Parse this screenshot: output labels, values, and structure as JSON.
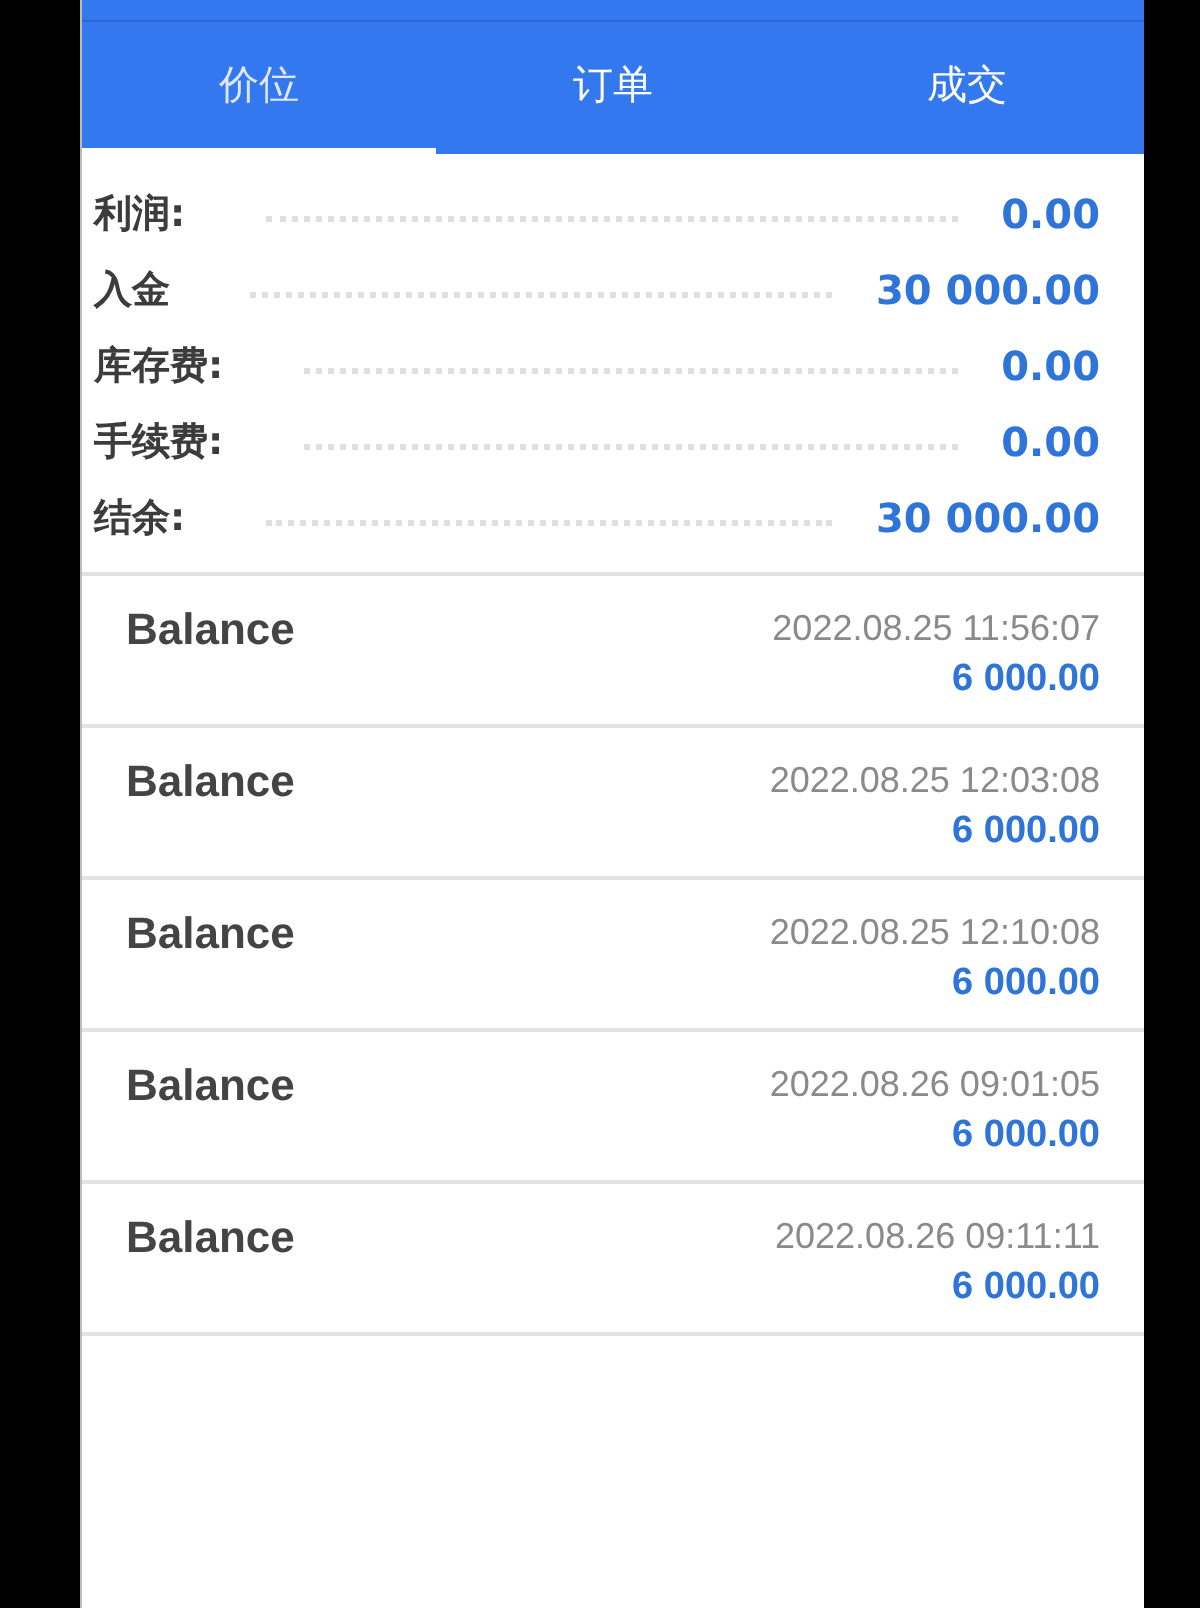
{
  "tabs": [
    {
      "label": "价位",
      "selected": true
    },
    {
      "label": "订单",
      "selected": false
    },
    {
      "label": "成交",
      "selected": false
    }
  ],
  "summary": [
    {
      "label": "利润:",
      "value": "0.00"
    },
    {
      "label": "入金",
      "value": "30 000.00"
    },
    {
      "label": "库存费:",
      "value": "0.00"
    },
    {
      "label": "手续费:",
      "value": "0.00"
    },
    {
      "label": "结余:",
      "value": "30 000.00"
    }
  ],
  "deals": [
    {
      "type": "Balance",
      "time": "2022.08.25 11:56:07",
      "amount": "6 000.00"
    },
    {
      "type": "Balance",
      "time": "2022.08.25 12:03:08",
      "amount": "6 000.00"
    },
    {
      "type": "Balance",
      "time": "2022.08.25 12:10:08",
      "amount": "6 000.00"
    },
    {
      "type": "Balance",
      "time": "2022.08.26 09:01:05",
      "amount": "6 000.00"
    },
    {
      "type": "Balance",
      "time": "2022.08.26 09:11:11",
      "amount": "6 000.00"
    }
  ]
}
